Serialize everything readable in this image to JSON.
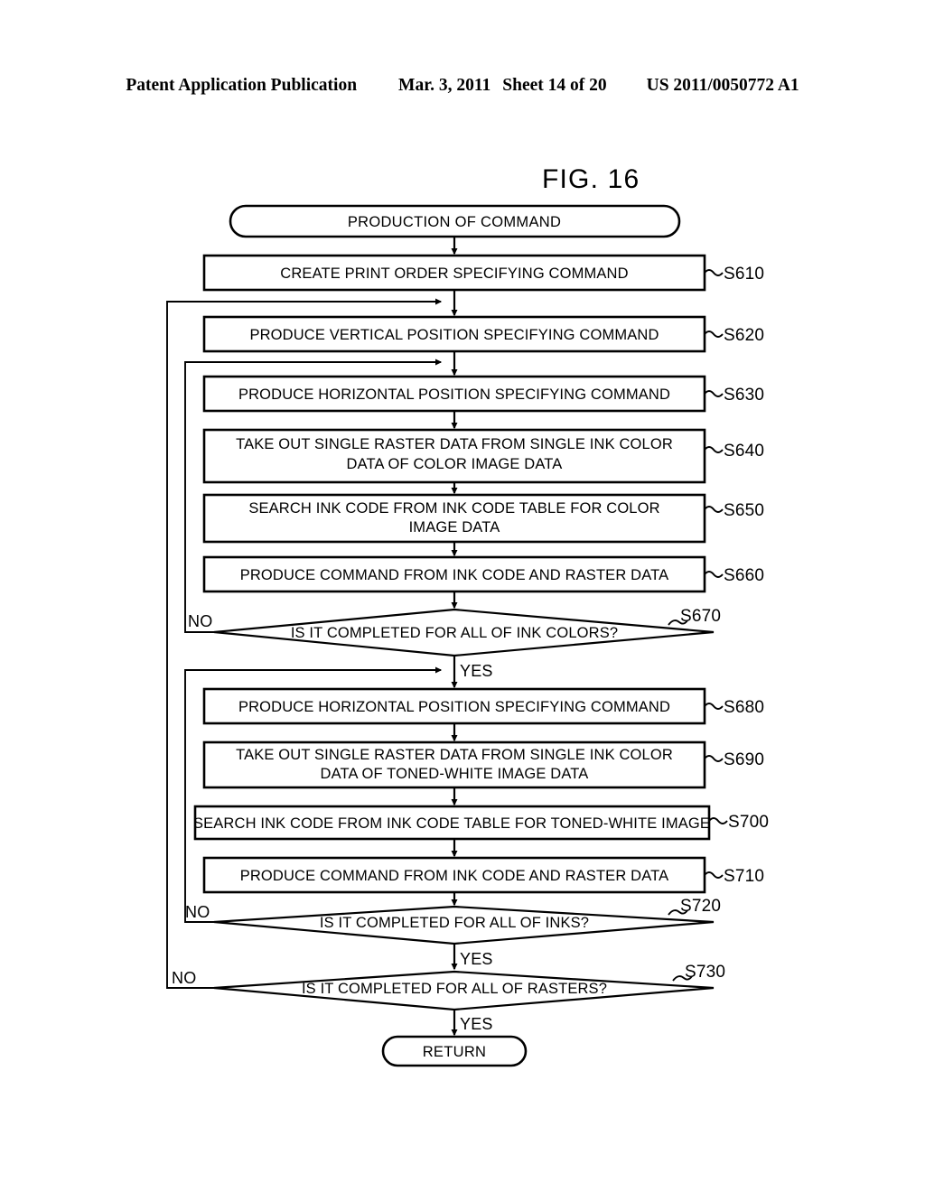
{
  "header": {
    "publication": "Patent Application Publication",
    "date": "Mar. 3, 2011",
    "sheet": "Sheet 14 of 20",
    "number": "US 2011/0050772 A1"
  },
  "figure": {
    "title": "FIG. 16"
  },
  "flowchart": {
    "type": "flowchart",
    "start": {
      "label": "PRODUCTION OF COMMAND",
      "shape": "terminator"
    },
    "end": {
      "label": "RETURN",
      "shape": "terminator"
    },
    "steps": [
      {
        "id": "S610",
        "label": "CREATE PRINT ORDER SPECIFYING COMMAND",
        "shape": "process",
        "lines": [
          "CREATE PRINT ORDER SPECIFYING COMMAND"
        ]
      },
      {
        "id": "S620",
        "label": "PRODUCE VERTICAL POSITION SPECIFYING COMMAND",
        "shape": "process",
        "lines": [
          "PRODUCE VERTICAL POSITION SPECIFYING COMMAND"
        ]
      },
      {
        "id": "S630",
        "label": "PRODUCE HORIZONTAL POSITION SPECIFYING COMMAND",
        "shape": "process",
        "lines": [
          "PRODUCE HORIZONTAL POSITION SPECIFYING COMMAND"
        ]
      },
      {
        "id": "S640",
        "label": "TAKE OUT SINGLE RASTER DATA FROM SINGLE INK COLOR DATA OF COLOR IMAGE DATA",
        "shape": "process",
        "lines": [
          "TAKE OUT SINGLE RASTER DATA FROM SINGLE INK COLOR",
          "DATA OF COLOR IMAGE DATA"
        ]
      },
      {
        "id": "S650",
        "label": "SEARCH INK CODE FROM INK CODE TABLE FOR  COLOR IMAGE DATA",
        "shape": "process",
        "lines": [
          "SEARCH INK CODE FROM INK CODE TABLE FOR  COLOR",
          "IMAGE DATA"
        ]
      },
      {
        "id": "S660",
        "label": "PRODUCE COMMAND FROM INK CODE AND RASTER DATA",
        "shape": "process",
        "lines": [
          "PRODUCE COMMAND FROM INK CODE AND RASTER DATA"
        ]
      },
      {
        "id": "S670",
        "label": "IS IT COMPLETED FOR ALL OF INK COLORS?",
        "shape": "decision",
        "yes": "YES",
        "no": "NO"
      },
      {
        "id": "S680",
        "label": "PRODUCE HORIZONTAL POSITION SPECIFYING COMMAND",
        "shape": "process",
        "lines": [
          "PRODUCE HORIZONTAL POSITION SPECIFYING COMMAND"
        ]
      },
      {
        "id": "S690",
        "label": "TAKE OUT SINGLE RASTER DATA FROM SINGLE INK COLOR DATA OF TONED-WHITE IMAGE DATA",
        "shape": "process",
        "lines": [
          "TAKE OUT SINGLE RASTER DATA FROM SINGLE INK COLOR",
          "DATA OF TONED-WHITE IMAGE DATA"
        ]
      },
      {
        "id": "S700",
        "label": "SEARCH INK CODE FROM INK CODE TABLE FOR  TONED-WHITE IMAGE",
        "shape": "process",
        "lines": [
          "SEARCH INK CODE FROM INK CODE TABLE FOR  TONED-WHITE IMAGE"
        ]
      },
      {
        "id": "S710",
        "label": "PRODUCE COMMAND FROM INK CODE AND RASTER DATA",
        "shape": "process",
        "lines": [
          "PRODUCE COMMAND FROM INK CODE AND RASTER DATA"
        ]
      },
      {
        "id": "S720",
        "label": "IS IT COMPLETED FOR ALL OF INKS?",
        "shape": "decision",
        "yes": "YES",
        "no": "NO"
      },
      {
        "id": "S730",
        "label": "IS IT COMPLETED FOR ALL OF RASTERS?",
        "shape": "decision",
        "yes": "YES",
        "no": "NO"
      }
    ],
    "branch_labels": {
      "no_s670": "NO",
      "yes_s670": "YES",
      "no_s720": "NO",
      "yes_s720": "YES",
      "no_s730": "NO",
      "yes_s730": "YES"
    }
  }
}
